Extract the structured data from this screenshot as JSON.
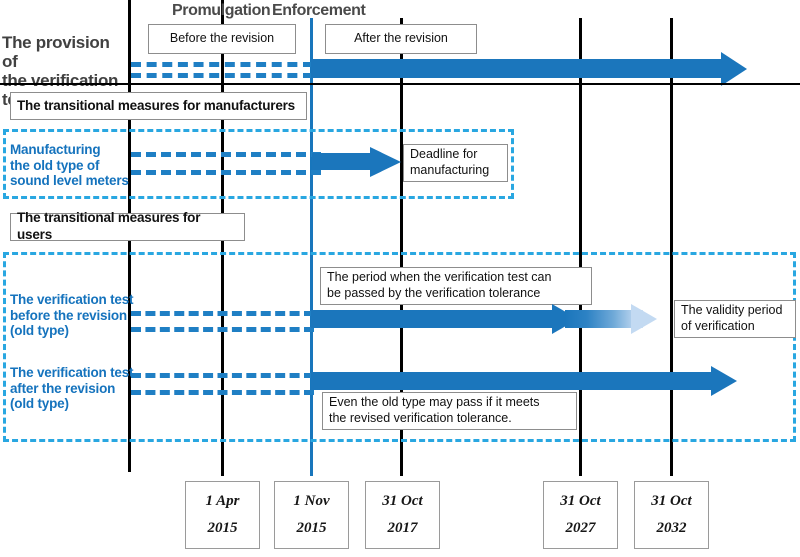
{
  "diagram": {
    "title_rows": [
      {
        "id": "provision",
        "text": "The provision of\nthe verification test"
      },
      {
        "id": "manufacturing",
        "text": "Manufacturing\nthe old type of\nsound level meters"
      },
      {
        "id": "verif_before",
        "text": "The verification test\nbefore the revision\n (old type)"
      },
      {
        "id": "verif_after",
        "text": "The verification test\nafter the revision\n (old type)"
      }
    ],
    "era_captions": [
      {
        "id": "promulgation",
        "label": "Promulgation"
      },
      {
        "id": "enforcement",
        "label": "Enforcement"
      }
    ],
    "period_boxes": [
      {
        "id": "before-revision",
        "label": "Before the revision"
      },
      {
        "id": "after-revision",
        "label": "After the revision"
      }
    ],
    "section_boxes": [
      {
        "id": "transitional-manufacturers",
        "label": "The transitional measures for manufacturers"
      },
      {
        "id": "transitional-users",
        "label": "The transitional measures for users"
      }
    ],
    "callouts": [
      {
        "id": "deadline-manufacturing",
        "label": "Deadline for\nmanufacturing"
      },
      {
        "id": "verification-tolerance-period",
        "label": "The period when the verification test can\nbe passed by the verification tolerance"
      },
      {
        "id": "validity-period",
        "label": "The validity period\nof verification"
      },
      {
        "id": "old-type-may-pass",
        "label": "Even the old type may pass if it meets\nthe revised verification tolerance."
      }
    ],
    "timeline_dates": [
      {
        "id": "date-2015-04-01",
        "day": "1 Apr",
        "year": "2015",
        "marker_color": "#000000"
      },
      {
        "id": "date-2015-11-01",
        "day": "1 Nov",
        "year": "2015",
        "marker_color": "#1876bc"
      },
      {
        "id": "date-2017-10-31",
        "day": "31 Oct",
        "year": "2017",
        "marker_color": "#000000"
      },
      {
        "id": "date-2027-10-31",
        "day": "31 Oct",
        "year": "2027",
        "marker_color": "#000000"
      },
      {
        "id": "date-2032-10-31",
        "day": "31 Oct",
        "year": "2032",
        "marker_color": "#000000"
      }
    ],
    "colors": {
      "arrow_blue": "#1b76bc",
      "dash_blue": "#1f7fc4",
      "container_dash_blue": "#29a7e1",
      "label_blue": "#1573bd",
      "rule_black": "#000000",
      "heading_gray": "#414141",
      "fade_end": "#cfe2f5"
    }
  }
}
